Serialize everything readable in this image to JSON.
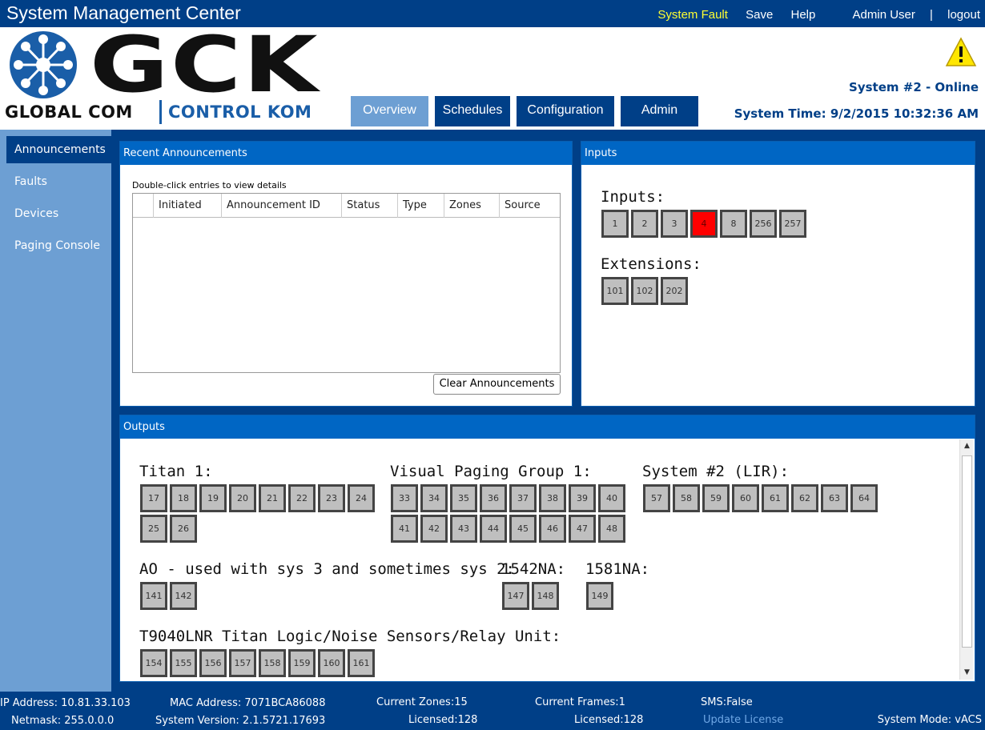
{
  "app": {
    "title": "System Management Center"
  },
  "top_links": {
    "fault": "System Fault",
    "save": "Save",
    "help": "Help",
    "user": "Admin User",
    "separator": "|",
    "logout": "logout"
  },
  "logo": {
    "letters": "GCK",
    "left_text": "GLOBAL COM",
    "right_text": "CONTROL KOM"
  },
  "nav": {
    "tabs": [
      {
        "label": "Overview",
        "active": true
      },
      {
        "label": "Schedules"
      },
      {
        "label": "Configuration"
      },
      {
        "label": "Admin"
      }
    ]
  },
  "header": {
    "warning_icon": "warning-triangle-icon",
    "system_status": "System #2 - Online",
    "system_time": "System Time: 9/2/2015 10:32:36 AM"
  },
  "sidebar": {
    "items": [
      {
        "label": "Announcements",
        "active": true
      },
      {
        "label": "Faults"
      },
      {
        "label": "Devices"
      },
      {
        "label": "Paging Console"
      }
    ]
  },
  "recent": {
    "title": "Recent Announcements",
    "hint": "Double-click entries to view details",
    "columns": [
      "Initiated",
      "Announcement ID",
      "Status",
      "Type",
      "Zones",
      "Source"
    ],
    "clear_label": "Clear Announcements"
  },
  "inputs": {
    "title": "Inputs",
    "inputs_label": "Inputs:",
    "inputs": [
      "1",
      "2",
      "3",
      "4",
      "8",
      "256",
      "257"
    ],
    "fault_input": "4",
    "extensions_label": "Extensions:",
    "extensions": [
      "101",
      "102",
      "202"
    ]
  },
  "outputs": {
    "title": "Outputs",
    "groups": [
      {
        "label": "Titan 1:",
        "tiles": [
          "17",
          "18",
          "19",
          "20",
          "21",
          "22",
          "23",
          "24",
          "25",
          "26"
        ]
      },
      {
        "label": "Visual Paging Group 1:",
        "tiles": [
          "33",
          "34",
          "35",
          "36",
          "37",
          "38",
          "39",
          "40",
          "41",
          "42",
          "43",
          "44",
          "45",
          "46",
          "47",
          "48"
        ]
      },
      {
        "label": "System #2 (LIR):",
        "tiles": [
          "57",
          "58",
          "59",
          "60",
          "61",
          "62",
          "63",
          "64"
        ]
      },
      {
        "label": "AO - used with sys 3 and sometimes sys 2:",
        "tiles": [
          "141",
          "142"
        ]
      },
      {
        "label": "1542NA:",
        "tiles": [
          "147",
          "148"
        ]
      },
      {
        "label": "1581NA:",
        "tiles": [
          "149"
        ]
      },
      {
        "label": "T9040LNR Titan Logic/Noise Sensors/Relay Unit:",
        "tiles": [
          "154",
          "155",
          "156",
          "157",
          "158",
          "159",
          "160",
          "161"
        ]
      }
    ]
  },
  "footer": {
    "ip": "IP Address: 10.81.33.103",
    "netmask": "Netmask: 255.0.0.0",
    "mac": "MAC Address: 7071BCA86088",
    "version": "System Version:  2.1.5721.17693",
    "zones": "Current Zones:15",
    "zones_licensed": "Licensed:128",
    "frames": "Current Frames:1",
    "frames_licensed": "Licensed:128",
    "sms": "SMS:False",
    "update_license": "Update License",
    "mode": "System Mode:  vACS"
  },
  "colors": {
    "navy": "#003f87",
    "sidebar": "#6d9fd3",
    "panel_header": "#0066c4",
    "fault_red": "#ff0000",
    "fault_text": "#ffff33",
    "link_blue": "#6fa8e6"
  }
}
